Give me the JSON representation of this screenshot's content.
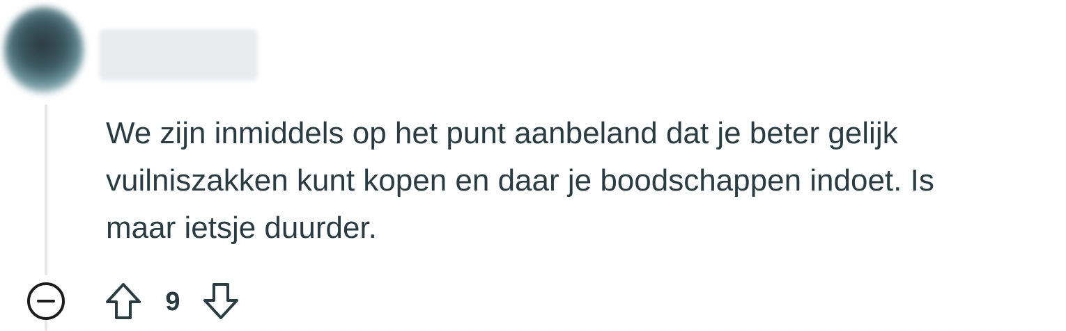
{
  "comment": {
    "author": "",
    "avatar_icon": "user-avatar-icon",
    "body_lines": [
      "We zijn inmiddels op het punt aanbeland dat je beter gelijk",
      "vuilniszakken kunt kopen en daar je boodschappen indoet. Is",
      "maar ietsje duurder."
    ],
    "score": "9"
  },
  "actions": {
    "collapse_icon": "minus-circle-icon",
    "upvote_icon": "arrow-up-icon",
    "downvote_icon": "arrow-down-icon"
  },
  "colors": {
    "text": "#2a3c42",
    "thread_line": "#e5e9eb",
    "background": "#ffffff"
  }
}
